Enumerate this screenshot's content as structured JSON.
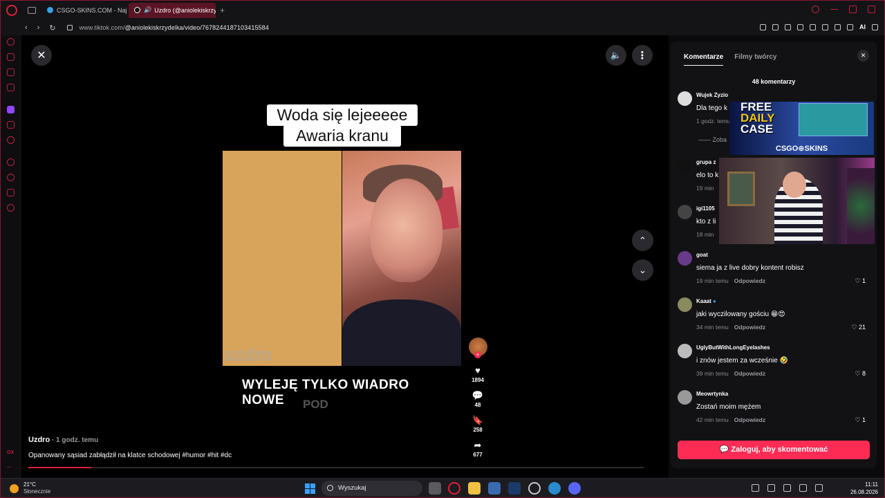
{
  "browser": {
    "tabs": [
      {
        "label": "CSGO-SKINS.COM - Najlep"
      },
      {
        "label": "Uzdro (@aniolekiskrzy"
      }
    ],
    "new_tab": "+",
    "url_prefix": "www.tiktok.com/",
    "url_rest": "@aniolekiskrzydelka/video/7678244187103415584",
    "ai_label": "AI"
  },
  "sidebar": {
    "gx_label": "GX",
    "more_label": "..."
  },
  "video": {
    "caption_line1": "Woda się lejeeeee",
    "caption_line2": "Awaria kranu",
    "watermark": "uzdro",
    "subtitle": "WYLEJĘ TYLKO WIADRO NOWE",
    "subtitle2": "POD",
    "author": "Uzdro",
    "time": " · 1 godz. temu",
    "description": "Opanowany sąsiad zabłądził na klatce schodowej #humor #hit #dc",
    "likes": "1894",
    "comments": "48",
    "saves": "258",
    "shares": "677"
  },
  "comments_panel": {
    "tab_comments": "Komentarze",
    "tab_creator": "Filmy twórcy",
    "count": "48 komentarzy",
    "more_replies": "Zoba",
    "reply_label": "Odpowiedz",
    "login_button": "Zaloguj, aby skomentować",
    "items": [
      {
        "user": "Wujek Zyzio",
        "text": "Dla tego k",
        "time": "1 godz. temu",
        "likes": ""
      },
      {
        "user": "grupa z",
        "text": "elo to k",
        "time": "19 min",
        "likes": ""
      },
      {
        "user": "igi1105",
        "text": "kto z li",
        "time": "18 min",
        "likes": ""
      },
      {
        "user": "goat",
        "text": "siema ja z live dobry kontent robisz",
        "time": "19 min temu",
        "likes": "1"
      },
      {
        "user": "Kaaat",
        "text": "jaki wyczilowany gościu 😁😍",
        "time": "34 min temu",
        "likes": "21"
      },
      {
        "user": "UglyButWithLongEyelashes",
        "text": "i znów jestem za wcześnie 🤣",
        "time": "39 min temu",
        "likes": "8"
      },
      {
        "user": "Meowrtynka",
        "text": "Zostań moim mężem",
        "time": "42 min temu",
        "likes": "1"
      }
    ]
  },
  "ad": {
    "line1": "FREE",
    "line2": "DAILY",
    "line3": "CASE",
    "brand": "CSGO⊕SKINS"
  },
  "taskbar": {
    "temperature": "21°C",
    "condition": "Słonecznie",
    "search": "Wyszukaj",
    "time": "11:11",
    "date": "26.08.2026"
  }
}
